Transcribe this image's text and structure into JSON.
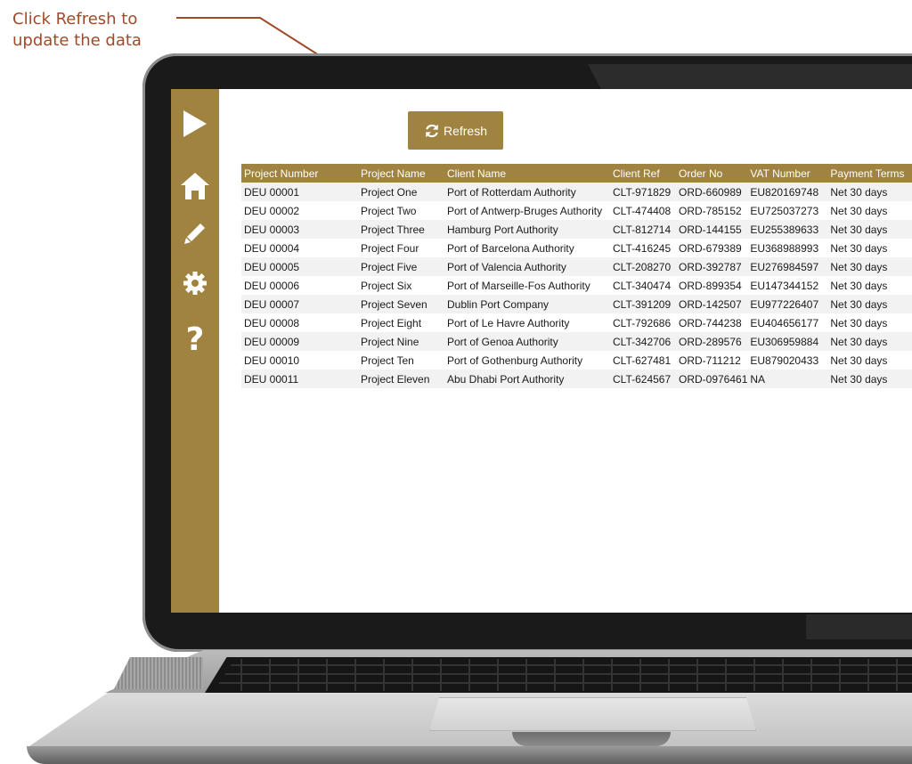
{
  "annotation": {
    "line1": "Click Refresh to",
    "line2": "update the data"
  },
  "sidebar": {
    "items": [
      {
        "name": "play",
        "icon": "play-icon"
      },
      {
        "name": "home",
        "icon": "home-icon"
      },
      {
        "name": "edit",
        "icon": "pencil-icon"
      },
      {
        "name": "settings",
        "icon": "gear-icon"
      },
      {
        "name": "help",
        "icon": "question-icon",
        "label": "?"
      }
    ]
  },
  "toolbar": {
    "refresh_label": "Refresh",
    "refresh_icon": "refresh-icon"
  },
  "table": {
    "columns": [
      "Project Number",
      "Project Name",
      "Client Name",
      "Client Ref",
      "Order No",
      "VAT Number",
      "Payment Terms"
    ],
    "rows": [
      [
        "DEU 00001",
        "Project One",
        "Port of Rotterdam Authority",
        "CLT-971829",
        "ORD-660989",
        "EU820169748",
        "Net 30 days"
      ],
      [
        "DEU 00002",
        "Project Two",
        "Port of Antwerp-Bruges Authority",
        "CLT-474408",
        "ORD-785152",
        "EU725037273",
        "Net 30 days"
      ],
      [
        "DEU 00003",
        "Project Three",
        "Hamburg Port Authority",
        "CLT-812714",
        "ORD-144155",
        "EU255389633",
        "Net 30 days"
      ],
      [
        "DEU 00004",
        "Project Four",
        "Port of Barcelona Authority",
        "CLT-416245",
        "ORD-679389",
        "EU368988993",
        "Net 30 days"
      ],
      [
        "DEU 00005",
        "Project Five",
        "Port of Valencia Authority",
        "CLT-208270",
        "ORD-392787",
        "EU276984597",
        "Net 30 days"
      ],
      [
        "DEU 00006",
        "Project Six",
        "Port of Marseille-Fos Authority",
        "CLT-340474",
        "ORD-899354",
        "EU147344152",
        "Net 30 days"
      ],
      [
        "DEU 00007",
        "Project Seven",
        "Dublin Port Company",
        "CLT-391209",
        "ORD-142507",
        "EU977226407",
        "Net 30 days"
      ],
      [
        "DEU 00008",
        "Project Eight",
        "Port of Le Havre Authority",
        "CLT-792686",
        "ORD-744238",
        "EU404656177",
        "Net 30 days"
      ],
      [
        "DEU 00009",
        "Project Nine",
        "Port of Genoa Authority",
        "CLT-342706",
        "ORD-289576",
        "EU306959884",
        "Net 30 days"
      ],
      [
        "DEU 00010",
        "Project Ten",
        "Port of Gothenburg Authority",
        "CLT-627481",
        "ORD-711212",
        "EU879020433",
        "Net 30 days"
      ],
      [
        "DEU 00011",
        "Project Eleven",
        "Abu Dhabi Port Authority",
        "CLT-624567",
        "ORD-0976461",
        "NA",
        "Net 30 days"
      ]
    ]
  },
  "colors": {
    "accent": "#a08341",
    "annotation": "#a04a2a",
    "bezel": "#1a1a1a"
  }
}
